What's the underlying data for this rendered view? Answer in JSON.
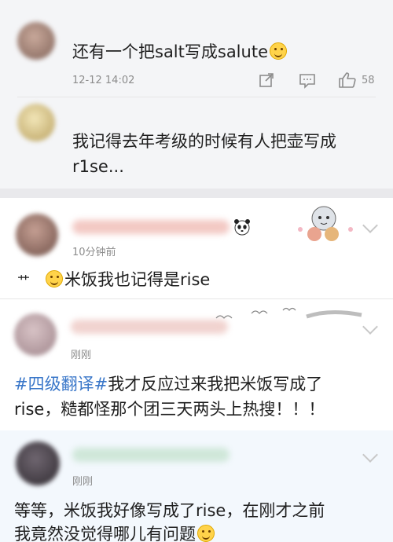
{
  "comments": [
    {
      "text_before": "还有一个把salt写成salute",
      "time": "12-12 14:02",
      "like_count": "58"
    },
    {
      "text_line1": "我记得去年考级的时候有人把壶写成",
      "text_line2": "r1se..."
    },
    {
      "time": "10分钟前",
      "prefix": "艹",
      "text": "米饭我也记得是rise"
    },
    {
      "time": "刚刚",
      "hashtag": "#四级翻译#",
      "text_line1": "我才反应过来我把米饭写成了",
      "text_line2": "rise，糙都怪那个团三天两头上热搜！！！"
    },
    {
      "time": "刚刚",
      "text_line1": "等等，米饭我好像写成了rise，在刚才之前",
      "text_line2": "我竟然没觉得哪儿有问题"
    }
  ],
  "colors": {
    "background": "#ffffff",
    "reply_background": "#f4f5f7",
    "divider": "#e6e6e6",
    "meta_text": "#8c8c8c",
    "hashtag": "#3a77c9"
  },
  "icons": [
    "share-icon",
    "comment-icon",
    "like-icon",
    "chevron-down-icon",
    "panda-icon",
    "laugh-emoji-icon",
    "smile-emoji-icon"
  ]
}
